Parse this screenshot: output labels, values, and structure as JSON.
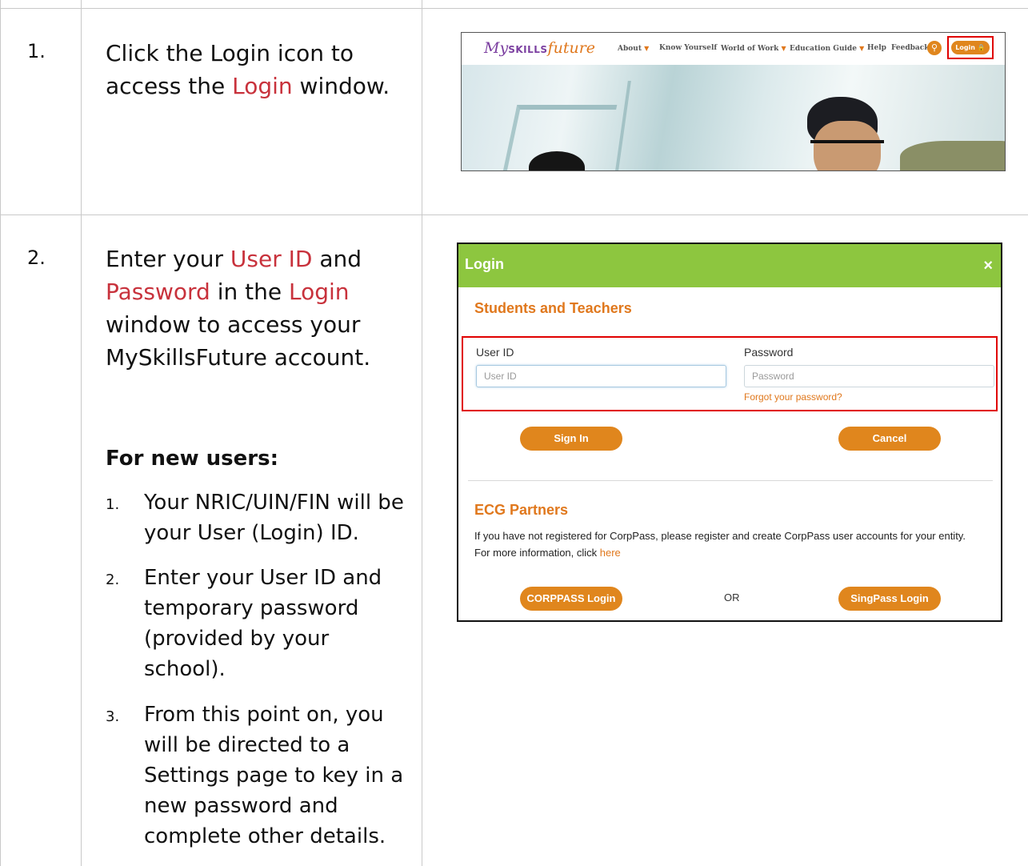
{
  "steps": [
    {
      "number": "1.",
      "instruction": {
        "pre": "Click the Login icon to access the ",
        "highlight": "Login",
        "post": " window."
      }
    },
    {
      "number": "2.",
      "instruction": {
        "p1": "Enter your ",
        "h1": "User ID",
        "p2": " and ",
        "h2": "Password",
        "p3": " in the ",
        "h3": "Login",
        "p4": " window to access your MySkillsFuture account."
      },
      "new_users_heading": "For new users:",
      "new_users_items": [
        {
          "n": "1.",
          "text": "Your NRIC/UIN/FIN will be your User (Login) ID."
        },
        {
          "n": "2.",
          "text": "Enter your User ID and temporary password (provided by your school)."
        },
        {
          "n": "3.",
          "text": "From this point on, you will be directed to a Settings page to key in a new password and complete other details."
        }
      ]
    }
  ],
  "site_header": {
    "logo_my": "My",
    "logo_skills": "SKILLS",
    "logo_future": "future",
    "nav": [
      {
        "label": "About",
        "caret": "▼"
      },
      {
        "label": "Know Yourself",
        "caret": ""
      },
      {
        "label": "World of Work",
        "caret": "▼"
      },
      {
        "label": "Education Guide",
        "caret": "▼"
      },
      {
        "label": "Help",
        "caret": ""
      },
      {
        "label": "Feedback",
        "caret": ""
      }
    ],
    "search_icon": "⚲",
    "login_label": "Login 🔒"
  },
  "login_dialog": {
    "title": "Login",
    "close": "×",
    "students_heading": "Students and Teachers",
    "user_id_label": "User ID",
    "user_id_placeholder": "User ID",
    "password_label": "Password",
    "password_placeholder": "Password",
    "forgot_link": "Forgot your password?",
    "sign_in": "Sign In",
    "cancel": "Cancel",
    "ecg_heading": "ECG Partners",
    "ecg_text": "If you have not registered for CorpPass, please register and create CorpPass user accounts for your entity. For more information, click ",
    "ecg_link": "here",
    "corppass_login": "CORPPASS Login",
    "or": "OR",
    "singpass_login": "SingPass Login"
  },
  "colors": {
    "accent_orange": "#e0861d",
    "header_green": "#8dc63f",
    "highlight_red": "#c8323c",
    "box_red": "#e00000"
  }
}
